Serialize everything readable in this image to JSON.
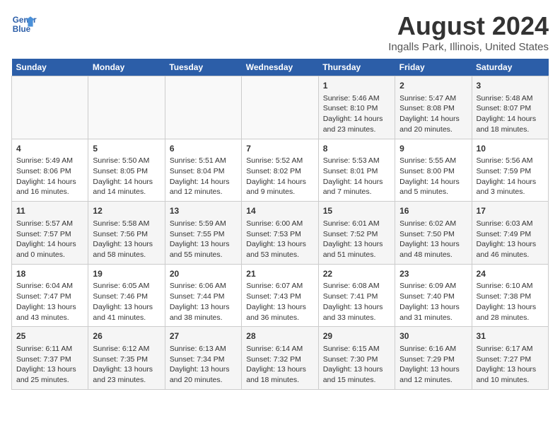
{
  "logo": {
    "line1": "General",
    "line2": "Blue"
  },
  "title": "August 2024",
  "subtitle": "Ingalls Park, Illinois, United States",
  "weekdays": [
    "Sunday",
    "Monday",
    "Tuesday",
    "Wednesday",
    "Thursday",
    "Friday",
    "Saturday"
  ],
  "weeks": [
    [
      {
        "day": "",
        "detail": ""
      },
      {
        "day": "",
        "detail": ""
      },
      {
        "day": "",
        "detail": ""
      },
      {
        "day": "",
        "detail": ""
      },
      {
        "day": "1",
        "detail": "Sunrise: 5:46 AM\nSunset: 8:10 PM\nDaylight: 14 hours\nand 23 minutes."
      },
      {
        "day": "2",
        "detail": "Sunrise: 5:47 AM\nSunset: 8:08 PM\nDaylight: 14 hours\nand 20 minutes."
      },
      {
        "day": "3",
        "detail": "Sunrise: 5:48 AM\nSunset: 8:07 PM\nDaylight: 14 hours\nand 18 minutes."
      }
    ],
    [
      {
        "day": "4",
        "detail": "Sunrise: 5:49 AM\nSunset: 8:06 PM\nDaylight: 14 hours\nand 16 minutes."
      },
      {
        "day": "5",
        "detail": "Sunrise: 5:50 AM\nSunset: 8:05 PM\nDaylight: 14 hours\nand 14 minutes."
      },
      {
        "day": "6",
        "detail": "Sunrise: 5:51 AM\nSunset: 8:04 PM\nDaylight: 14 hours\nand 12 minutes."
      },
      {
        "day": "7",
        "detail": "Sunrise: 5:52 AM\nSunset: 8:02 PM\nDaylight: 14 hours\nand 9 minutes."
      },
      {
        "day": "8",
        "detail": "Sunrise: 5:53 AM\nSunset: 8:01 PM\nDaylight: 14 hours\nand 7 minutes."
      },
      {
        "day": "9",
        "detail": "Sunrise: 5:55 AM\nSunset: 8:00 PM\nDaylight: 14 hours\nand 5 minutes."
      },
      {
        "day": "10",
        "detail": "Sunrise: 5:56 AM\nSunset: 7:59 PM\nDaylight: 14 hours\nand 3 minutes."
      }
    ],
    [
      {
        "day": "11",
        "detail": "Sunrise: 5:57 AM\nSunset: 7:57 PM\nDaylight: 14 hours\nand 0 minutes."
      },
      {
        "day": "12",
        "detail": "Sunrise: 5:58 AM\nSunset: 7:56 PM\nDaylight: 13 hours\nand 58 minutes."
      },
      {
        "day": "13",
        "detail": "Sunrise: 5:59 AM\nSunset: 7:55 PM\nDaylight: 13 hours\nand 55 minutes."
      },
      {
        "day": "14",
        "detail": "Sunrise: 6:00 AM\nSunset: 7:53 PM\nDaylight: 13 hours\nand 53 minutes."
      },
      {
        "day": "15",
        "detail": "Sunrise: 6:01 AM\nSunset: 7:52 PM\nDaylight: 13 hours\nand 51 minutes."
      },
      {
        "day": "16",
        "detail": "Sunrise: 6:02 AM\nSunset: 7:50 PM\nDaylight: 13 hours\nand 48 minutes."
      },
      {
        "day": "17",
        "detail": "Sunrise: 6:03 AM\nSunset: 7:49 PM\nDaylight: 13 hours\nand 46 minutes."
      }
    ],
    [
      {
        "day": "18",
        "detail": "Sunrise: 6:04 AM\nSunset: 7:47 PM\nDaylight: 13 hours\nand 43 minutes."
      },
      {
        "day": "19",
        "detail": "Sunrise: 6:05 AM\nSunset: 7:46 PM\nDaylight: 13 hours\nand 41 minutes."
      },
      {
        "day": "20",
        "detail": "Sunrise: 6:06 AM\nSunset: 7:44 PM\nDaylight: 13 hours\nand 38 minutes."
      },
      {
        "day": "21",
        "detail": "Sunrise: 6:07 AM\nSunset: 7:43 PM\nDaylight: 13 hours\nand 36 minutes."
      },
      {
        "day": "22",
        "detail": "Sunrise: 6:08 AM\nSunset: 7:41 PM\nDaylight: 13 hours\nand 33 minutes."
      },
      {
        "day": "23",
        "detail": "Sunrise: 6:09 AM\nSunset: 7:40 PM\nDaylight: 13 hours\nand 31 minutes."
      },
      {
        "day": "24",
        "detail": "Sunrise: 6:10 AM\nSunset: 7:38 PM\nDaylight: 13 hours\nand 28 minutes."
      }
    ],
    [
      {
        "day": "25",
        "detail": "Sunrise: 6:11 AM\nSunset: 7:37 PM\nDaylight: 13 hours\nand 25 minutes."
      },
      {
        "day": "26",
        "detail": "Sunrise: 6:12 AM\nSunset: 7:35 PM\nDaylight: 13 hours\nand 23 minutes."
      },
      {
        "day": "27",
        "detail": "Sunrise: 6:13 AM\nSunset: 7:34 PM\nDaylight: 13 hours\nand 20 minutes."
      },
      {
        "day": "28",
        "detail": "Sunrise: 6:14 AM\nSunset: 7:32 PM\nDaylight: 13 hours\nand 18 minutes."
      },
      {
        "day": "29",
        "detail": "Sunrise: 6:15 AM\nSunset: 7:30 PM\nDaylight: 13 hours\nand 15 minutes."
      },
      {
        "day": "30",
        "detail": "Sunrise: 6:16 AM\nSunset: 7:29 PM\nDaylight: 13 hours\nand 12 minutes."
      },
      {
        "day": "31",
        "detail": "Sunrise: 6:17 AM\nSunset: 7:27 PM\nDaylight: 13 hours\nand 10 minutes."
      }
    ]
  ]
}
